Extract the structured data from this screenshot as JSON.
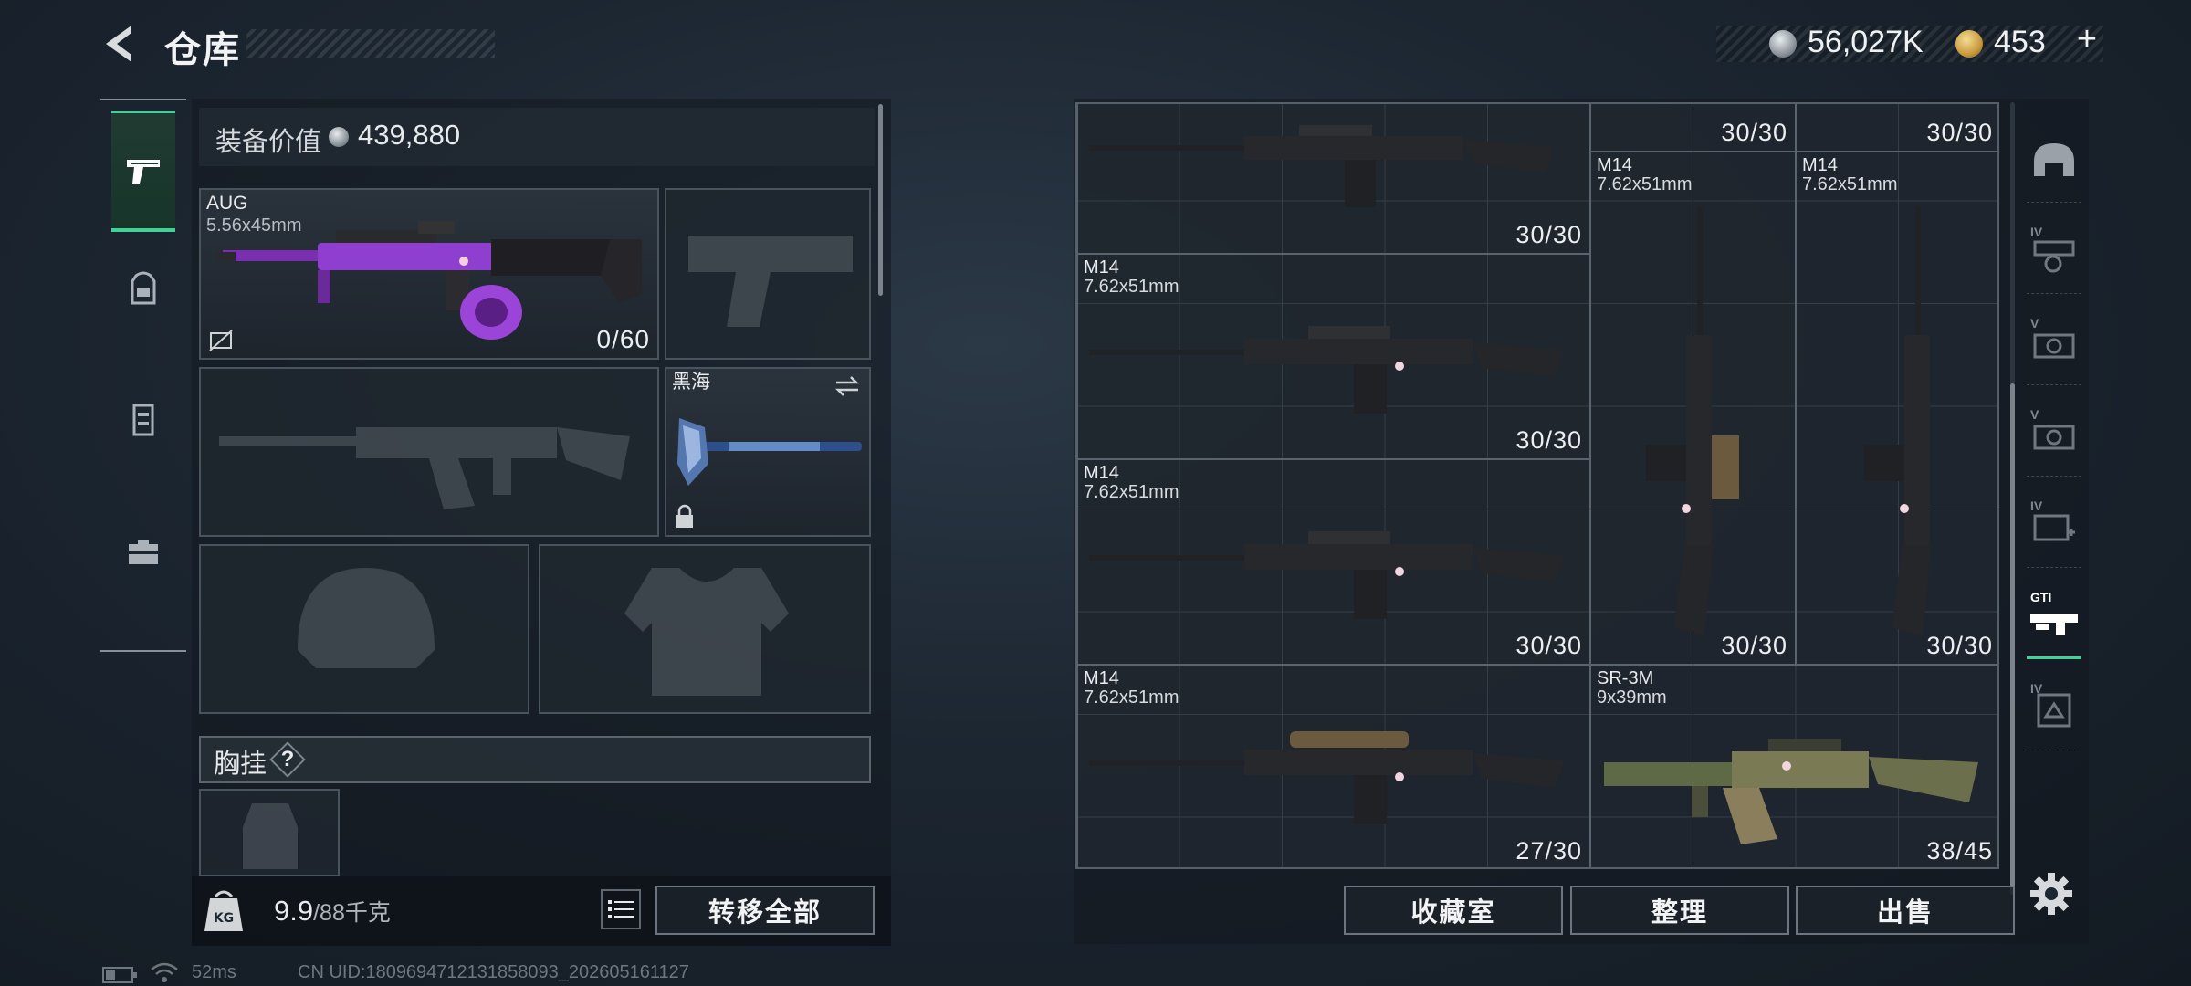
{
  "header": {
    "title": "仓库",
    "silver_amount": "56,027K",
    "gold_amount": "453",
    "plus_label": "+"
  },
  "categories": [
    {
      "name": "weapons",
      "icon": "pistol-icon",
      "active": true
    },
    {
      "name": "backpack",
      "icon": "backpack-icon",
      "active": false
    },
    {
      "name": "vest",
      "icon": "vest-icon",
      "active": false
    },
    {
      "name": "toolbox",
      "icon": "toolbox-icon",
      "active": false
    }
  ],
  "gear": {
    "value_label": "装备价值",
    "value_amount": "439,880",
    "primary": {
      "name": "AUG",
      "caliber": "5.56x45mm",
      "ammo": "0/60"
    },
    "melee": {
      "name": "黑海"
    },
    "chest_label": "胸挂",
    "help_label": "?",
    "weight_current": "9.9",
    "weight_max": "/88千克",
    "weight_icon_label": "KG",
    "transfer_all_label": "转移全部"
  },
  "stash": {
    "items": [
      {
        "name": "",
        "caliber": "",
        "ammo": "30/30"
      },
      {
        "name": "",
        "caliber": "",
        "ammo": "30/30"
      },
      {
        "name": "",
        "caliber": "",
        "ammo": "30/30"
      },
      {
        "name": "M14",
        "caliber": "7.62x51mm",
        "ammo": "30/30"
      },
      {
        "name": "M14",
        "caliber": "7.62x51mm",
        "ammo": "30/30"
      },
      {
        "name": "M14",
        "caliber": "7.62x51mm",
        "ammo": "30/30"
      },
      {
        "name": "M14",
        "caliber": "7.62x51mm",
        "ammo": "30/30"
      },
      {
        "name": "M14",
        "caliber": "7.62x51mm",
        "ammo": "27/30"
      },
      {
        "name": "SR-3M",
        "caliber": "9x39mm",
        "ammo": "38/45"
      }
    ],
    "buttons": {
      "collection": "收藏室",
      "organize": "整理",
      "sell": "出售"
    },
    "side_tabs": [
      {
        "icon": "helmet-icon",
        "tier": ""
      },
      {
        "icon": "scope-icon",
        "tier": "IV"
      },
      {
        "icon": "camera-icon",
        "tier": "V"
      },
      {
        "icon": "camera-icon",
        "tier": "V"
      },
      {
        "icon": "medkit-icon",
        "tier": "IV"
      },
      {
        "icon": "gun-rack-icon",
        "tier": "GTI"
      },
      {
        "icon": "armor-icon",
        "tier": "IV"
      }
    ]
  },
  "footer": {
    "ping": "52ms",
    "uid": "CN UID:1809694712131858093_202605161127"
  },
  "colors": {
    "accent": "#3fd39a",
    "border": "#56606a"
  }
}
